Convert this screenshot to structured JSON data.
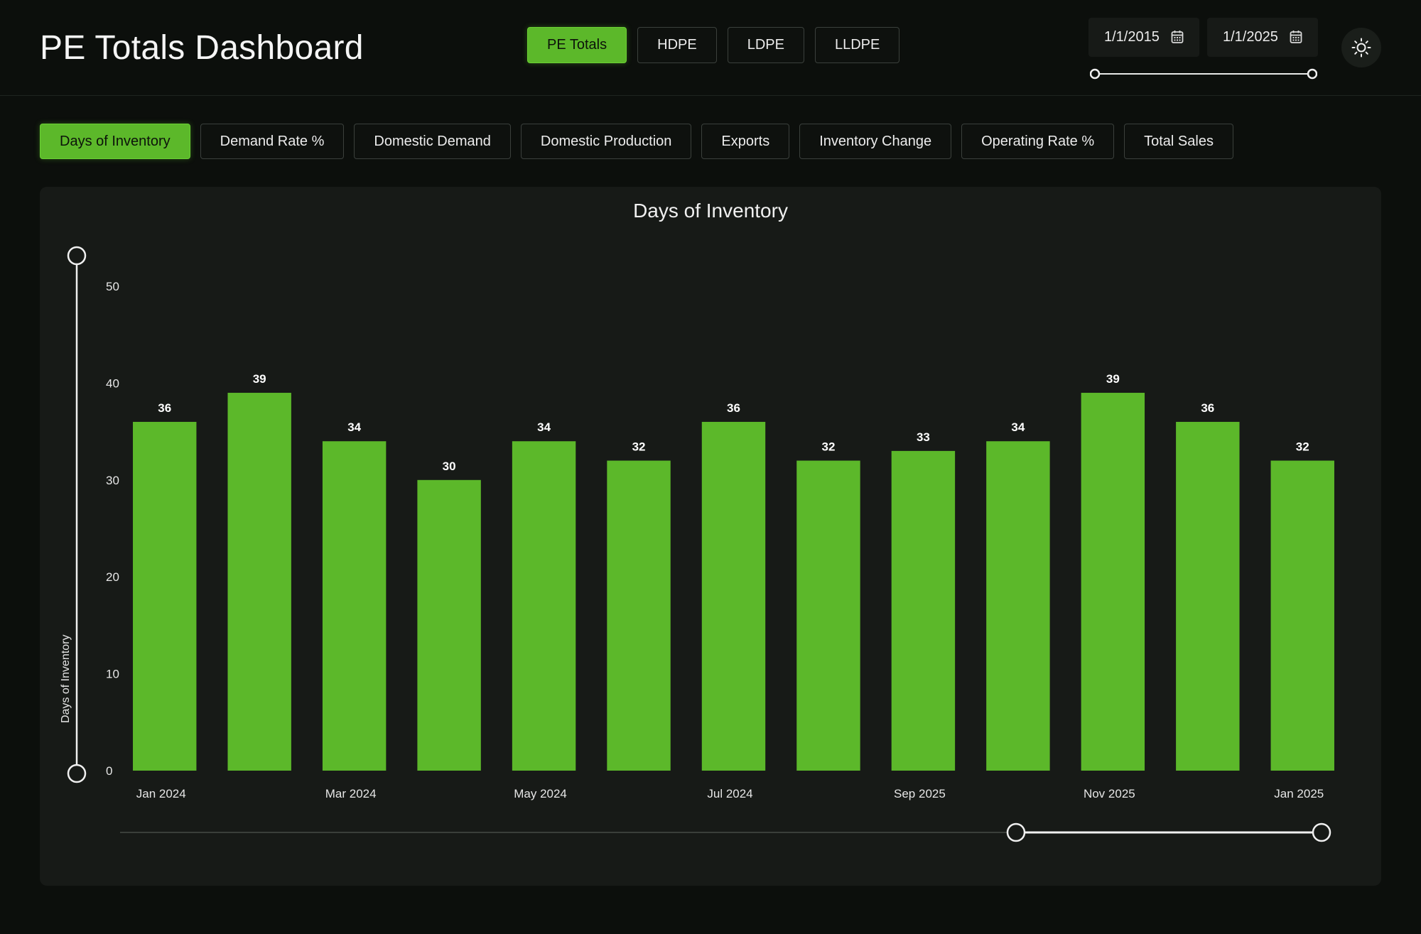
{
  "header": {
    "title": "PE Totals Dashboard",
    "product_tabs": [
      {
        "label": "PE Totals",
        "active": true
      },
      {
        "label": "HDPE",
        "active": false
      },
      {
        "label": "LDPE",
        "active": false
      },
      {
        "label": "LLDPE",
        "active": false
      }
    ],
    "start_date": "1/1/2015",
    "end_date": "1/1/2025",
    "calendar_icon": "calendar-icon",
    "theme_icon": "sun-icon"
  },
  "metric_tabs": [
    {
      "label": "Days of Inventory",
      "active": true
    },
    {
      "label": "Demand Rate %",
      "active": false
    },
    {
      "label": "Domestic Demand",
      "active": false
    },
    {
      "label": "Domestic Production",
      "active": false
    },
    {
      "label": "Exports",
      "active": false
    },
    {
      "label": "Inventory Change",
      "active": false
    },
    {
      "label": "Operating Rate %",
      "active": false
    },
    {
      "label": "Total Sales",
      "active": false
    }
  ],
  "colors": {
    "accent": "#5cb82a",
    "background": "#0c0f0c",
    "card": "#171a17"
  },
  "chart_data": {
    "type": "bar",
    "title": "Days of Inventory",
    "ylabel": "Days of Inventory",
    "xlabel": "",
    "ylim": [
      0,
      50
    ],
    "yticks": [
      0,
      10,
      20,
      30,
      40,
      50
    ],
    "categories": [
      "Jan 2024",
      "",
      "Mar 2024",
      "",
      "May 2024",
      "",
      "Jul 2024",
      "",
      "Sep 2025",
      "",
      "Nov 2025",
      "",
      "Jan 2025"
    ],
    "values": [
      36,
      39,
      34,
      30,
      34,
      32,
      36,
      32,
      33,
      34,
      39,
      36,
      32
    ],
    "data_labels": true,
    "grid": false,
    "range_selection": [
      0.75,
      1.0
    ]
  }
}
